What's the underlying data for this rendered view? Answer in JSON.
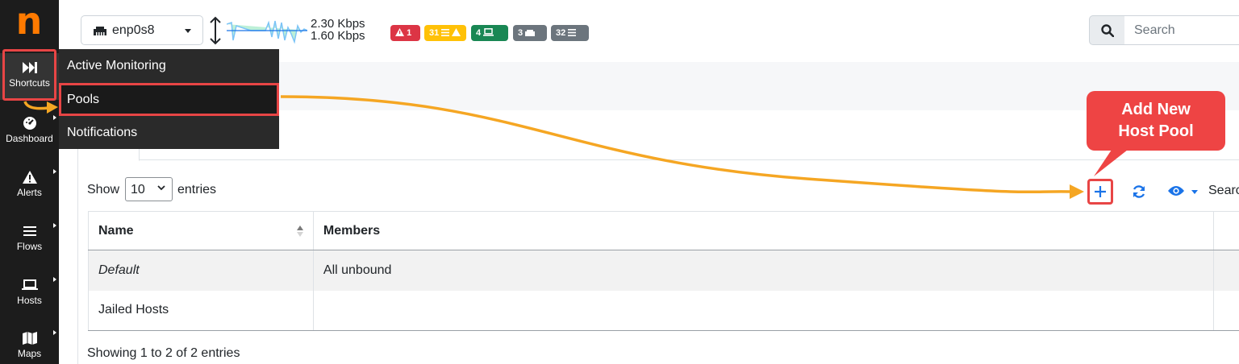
{
  "sidebar": {
    "logo": "n",
    "items": [
      {
        "label": "Shortcuts",
        "icon": "fast-forward-icon"
      },
      {
        "label": "Dashboard",
        "icon": "gauge-icon"
      },
      {
        "label": "Alerts",
        "icon": "warning-icon"
      },
      {
        "label": "Flows",
        "icon": "bars-icon"
      },
      {
        "label": "Hosts",
        "icon": "laptop-icon"
      },
      {
        "label": "Maps",
        "icon": "map-icon"
      }
    ]
  },
  "topbar": {
    "interface_name": "enp0s8",
    "rate_upload": "2.30 Kbps",
    "rate_download": "1.60 Kbps",
    "badges": {
      "alerts": "1",
      "flow_alerts": "31",
      "hosts": "4",
      "devices": "3",
      "flows": "32"
    },
    "search_placeholder": "Search"
  },
  "shortcuts_menu": {
    "items": [
      "Active Monitoring",
      "Pools",
      "Notifications"
    ]
  },
  "table_controls": {
    "show_label": "Show",
    "page_size": "10",
    "entries_label": "entries",
    "search_label": "Searc"
  },
  "pools_table": {
    "headers": [
      "Name",
      "Members"
    ],
    "rows": [
      {
        "name": "Default",
        "members": "All unbound"
      },
      {
        "name": "Jailed Hosts",
        "members": ""
      }
    ]
  },
  "footer": {
    "showing": "Showing 1 to 2 of 2 entries"
  },
  "annotation": {
    "callout_line1": "Add New",
    "callout_line2": "Host Pool"
  },
  "colors": {
    "accent": "#ff7a00",
    "annotation_red": "#e84545",
    "arrow": "#f5a623",
    "link_blue": "#1a73e8"
  }
}
